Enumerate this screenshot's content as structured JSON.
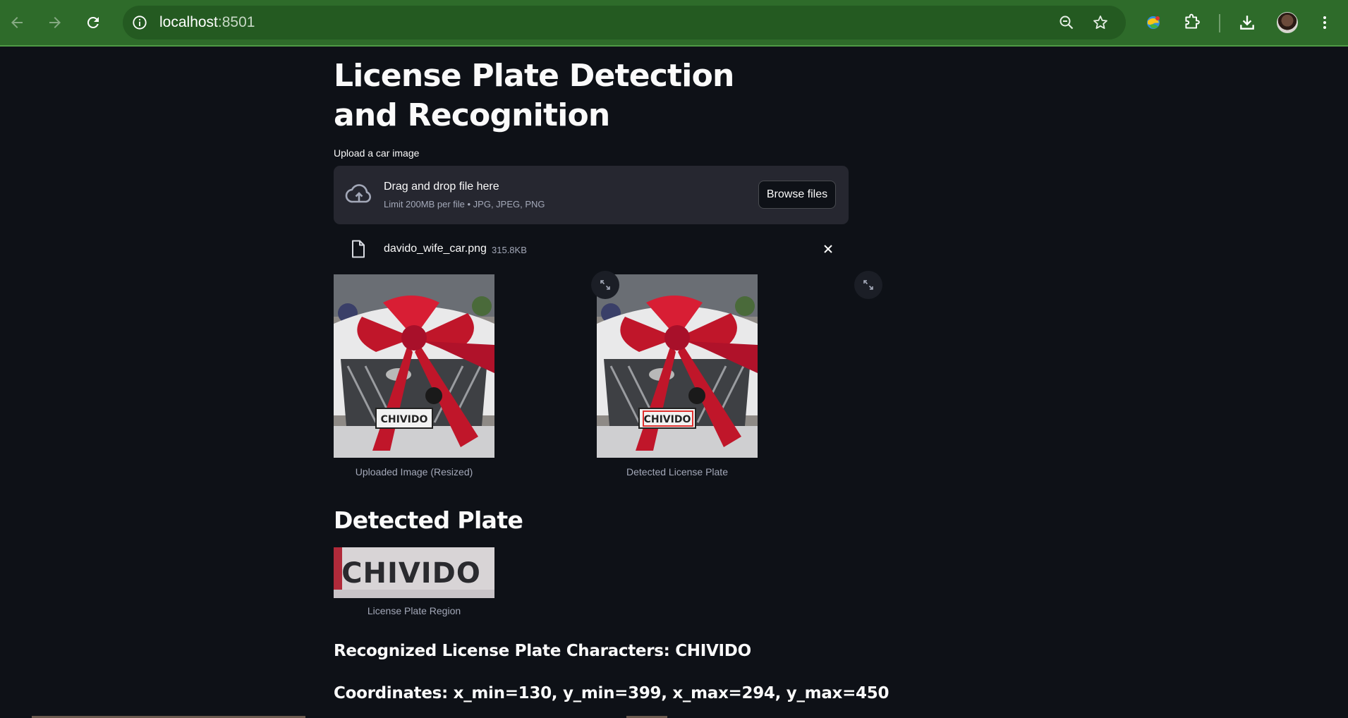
{
  "browser": {
    "url_host": "localhost",
    "url_port": ":8501",
    "icons": {
      "back": "arrow-left-icon",
      "forward": "arrow-right-icon",
      "reload": "reload-icon",
      "site_info": "info-icon",
      "zoom": "zoom-out-icon",
      "bookmark": "star-icon",
      "extension_colorful": "globe-extension-icon",
      "extensions": "puzzle-icon",
      "downloads": "download-icon",
      "profile": "avatar",
      "menu": "kebab-menu-icon"
    },
    "toolbar_color": "#2e6b2a"
  },
  "page": {
    "title": "License Plate Detection and Recognition",
    "theme_bg": "#0e1117",
    "accent_red": "#e0302e"
  },
  "uploader": {
    "label": "Upload a car image",
    "dropzone_title": "Drag and drop file here",
    "dropzone_limit": "Limit 200MB per file • JPG, JPEG, PNG",
    "browse_label": "Browse files",
    "file": {
      "name": "davido_wife_car.png",
      "size": "315.8KB"
    }
  },
  "images": {
    "uploaded_caption": "Uploaded Image (Resized)",
    "detected_caption": "Detected License Plate",
    "plate_text_on_car": "CHIVIDO"
  },
  "detected_section": {
    "heading": "Detected Plate",
    "plate_crop_text": "CHIVIDO",
    "plate_caption": "License Plate Region"
  },
  "results": {
    "recognized": "Recognized License Plate Characters: CHIVIDO",
    "coordinates": "Coordinates: x_min=130, y_min=399, x_max=294, y_max=450"
  }
}
